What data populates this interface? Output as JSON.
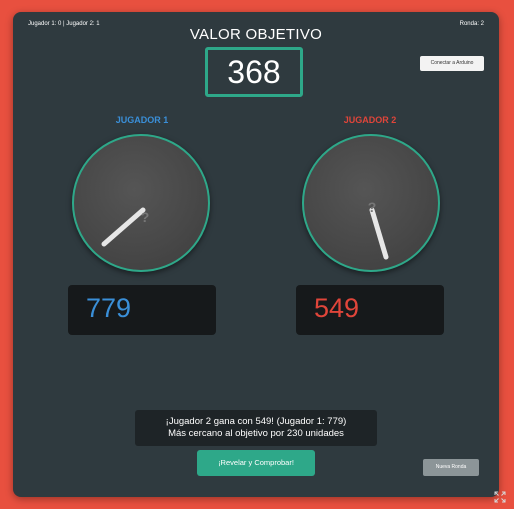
{
  "header": {
    "score_text": "Jugador 1: 0 | Jugador 2: 1",
    "round_text": "Ronda: 2",
    "target_label": "VALOR OBJETIVO",
    "target_value": "368",
    "connect_button": "Conectar a Arduino"
  },
  "players": [
    {
      "label": "JUGADOR 1",
      "value": "779",
      "color": "#3a8fd8",
      "dial_knob_icon": "question-mark-icon"
    },
    {
      "label": "JUGADOR 2",
      "value": "549",
      "color": "#e0453a",
      "dial_knob_icon": "question-mark-icon"
    }
  ],
  "result": {
    "line1": "¡Jugador 2 gana con 549! (Jugador 1: 779)",
    "line2": "Más cercano al objetivo por 230 unidades"
  },
  "buttons": {
    "reveal": "¡Revelar y Comprobar!",
    "next_round": "Nueva Ronda"
  },
  "icons": {
    "expand": "expand-icon"
  },
  "colors": {
    "background": "#e8503f",
    "panel": "#2f3a3f",
    "accent": "#2ea889",
    "player1": "#3a8fd8",
    "player2": "#e0453a"
  }
}
